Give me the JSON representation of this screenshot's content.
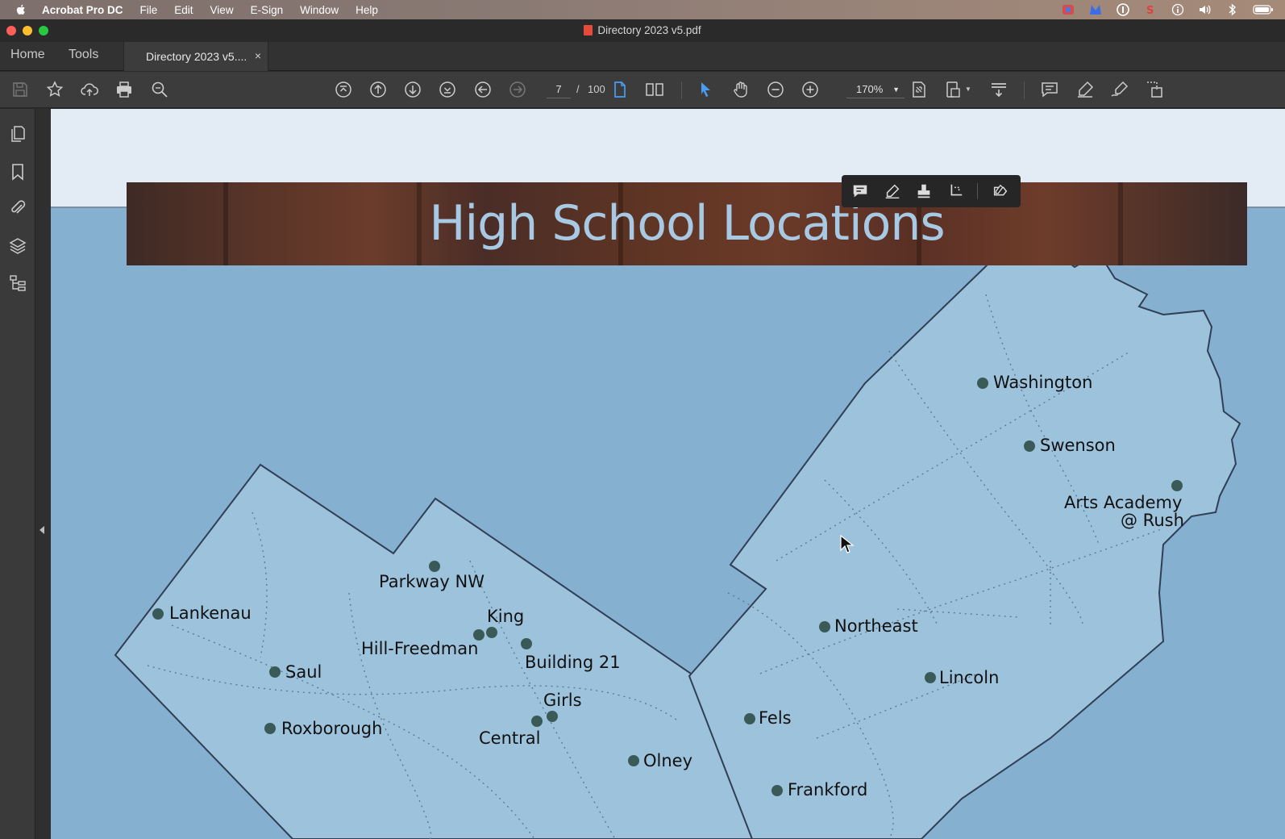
{
  "menubar": {
    "app_name": "Acrobat Pro DC",
    "items": [
      "File",
      "Edit",
      "View",
      "E-Sign",
      "Window",
      "Help"
    ]
  },
  "window": {
    "title": "Directory 2023 v5.pdf"
  },
  "tabs": {
    "home": "Home",
    "tools": "Tools",
    "document": "Directory 2023 v5....",
    "close": "×"
  },
  "toolbar": {
    "current_page": "7",
    "separator": "/",
    "total_pages": "100",
    "zoom": "170%"
  },
  "document": {
    "banner_title": "High School Locations",
    "locations": [
      "Washington",
      "Swenson",
      "Arts Academy",
      "@ Rush",
      "Parkway NW",
      "Lankenau",
      "King",
      "Hill-Freedman",
      "Building 21",
      "Saul",
      "Northeast",
      "Lincoln",
      "Girls",
      "Roxborough",
      "Central",
      "Fels",
      "Olney",
      "Frankford"
    ]
  },
  "colors": {
    "map_land": "#9dc2dc",
    "map_water": "#86b0d0",
    "marker": "#3a5a58",
    "banner_text": "#a7c9e4"
  }
}
